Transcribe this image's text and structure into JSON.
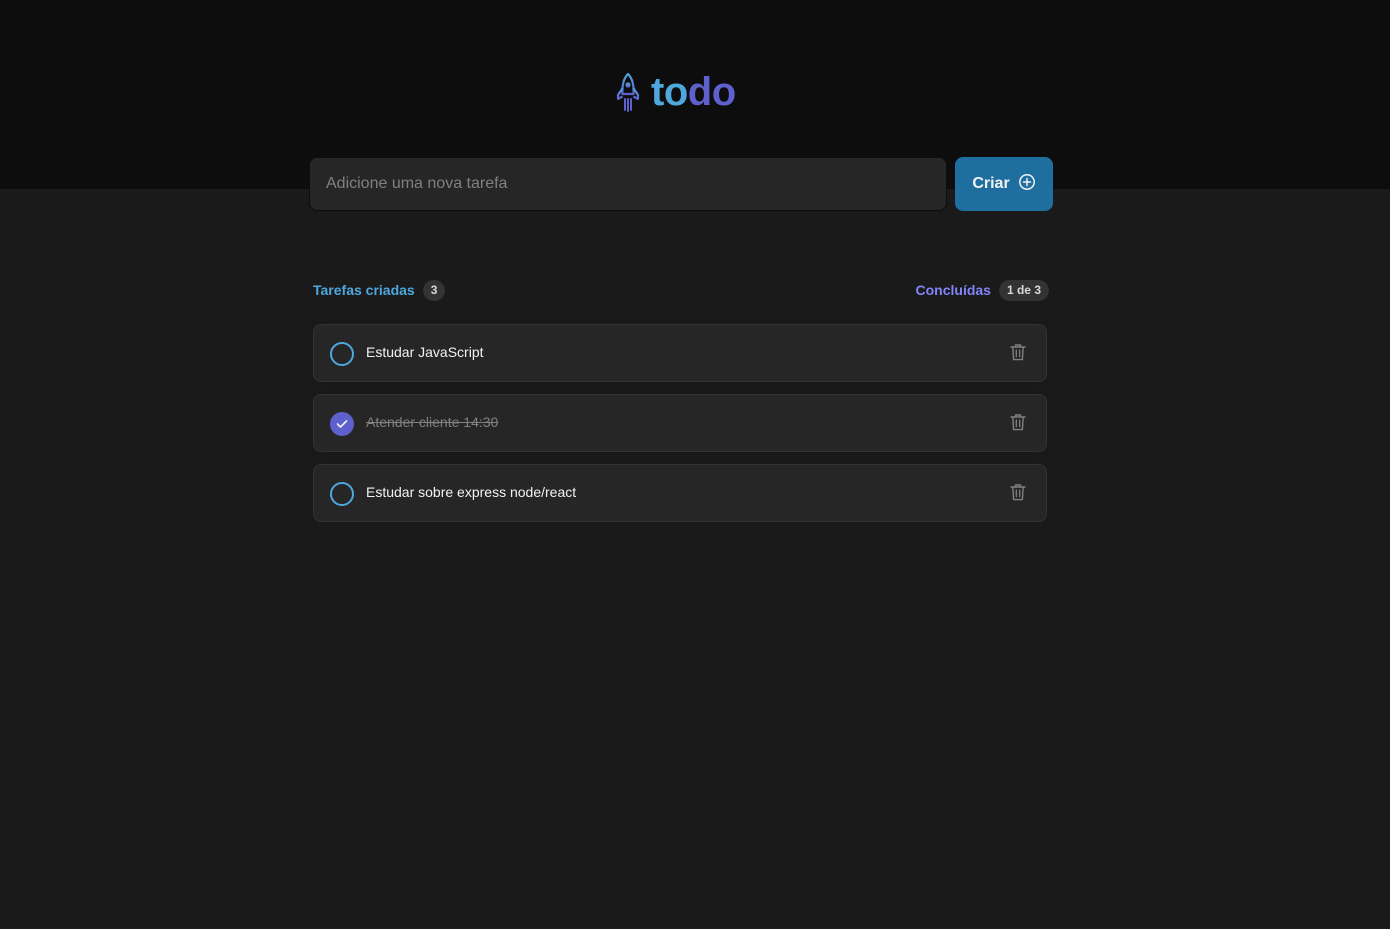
{
  "app": {
    "logo_text_part1": "to",
    "logo_text_part2": "do",
    "logo_icon": "rocket-icon"
  },
  "new_task": {
    "placeholder": "Adicione uma nova tarefa",
    "value": "",
    "create_label": "Criar",
    "create_icon": "plus-circle-icon"
  },
  "info": {
    "created_label": "Tarefas criadas",
    "created_count": "3",
    "done_label": "Concluídas",
    "done_count": "1 de 3"
  },
  "tasks": [
    {
      "text": "Estudar JavaScript",
      "done": false
    },
    {
      "text": "Atender cliente 14:30",
      "done": true
    },
    {
      "text": "Estudar sobre express node/react",
      "done": false
    }
  ],
  "colors": {
    "header_bg": "#0d0d0d",
    "body_bg": "#1a1a1a",
    "blue": "#4ea8de",
    "blue_dark": "#1e6f9f",
    "purple": "#5e60ce",
    "purple_light": "#8284fa",
    "card_bg": "#262626"
  }
}
